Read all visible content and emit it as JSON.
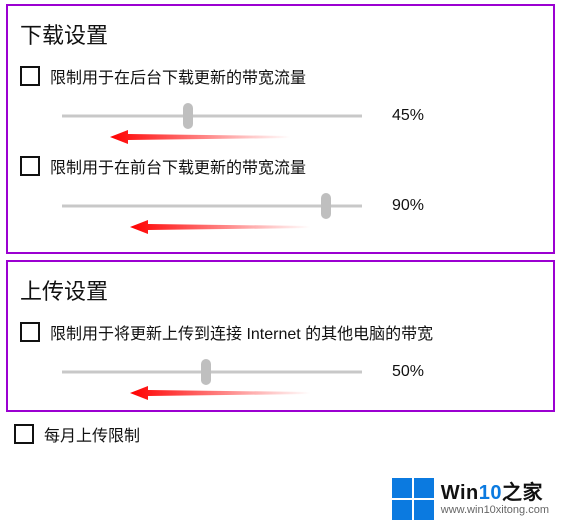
{
  "download": {
    "title": "下载设置",
    "bg_limit": {
      "label": "限制用于在后台下载更新的带宽流量",
      "value_text": "45%",
      "value": 45
    },
    "fg_limit": {
      "label": "限制用于在前台下载更新的带宽流量",
      "value_text": "90%",
      "value": 90
    }
  },
  "upload": {
    "title": "上传设置",
    "limit": {
      "label": "限制用于将更新上传到连接 Internet 的其他电脑的带宽",
      "value_text": "50%",
      "value": 50
    },
    "monthly_label": "每月上传限制"
  },
  "watermark": {
    "brand_a": "Win",
    "brand_b": "10",
    "brand_c": "之家",
    "url": "www.win10xitong.com"
  }
}
